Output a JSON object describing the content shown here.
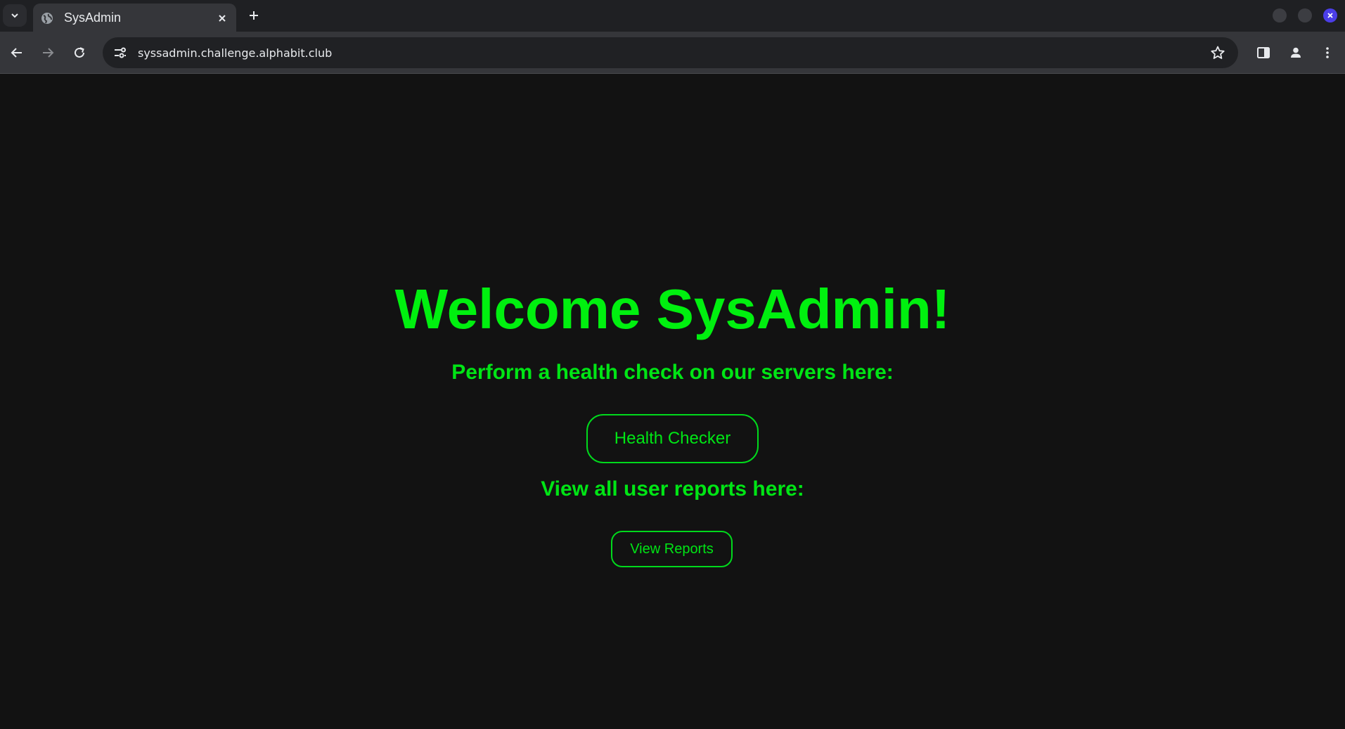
{
  "browser": {
    "tab": {
      "title": "SysAdmin"
    },
    "url": "syssadmin.challenge.alphabit.club",
    "colors": {
      "accent_close": "#4b3ee8",
      "toolbar": "#35363a",
      "tabstrip": "#1f2023"
    }
  },
  "page": {
    "heading": "Welcome SysAdmin!",
    "health_prompt": "Perform a health check on our servers here:",
    "health_button": "Health Checker",
    "reports_prompt": "View all user reports here:",
    "reports_button": "View Reports",
    "colors": {
      "background": "#121212",
      "text": "#00f00f",
      "button_border": "#00d91c"
    }
  }
}
